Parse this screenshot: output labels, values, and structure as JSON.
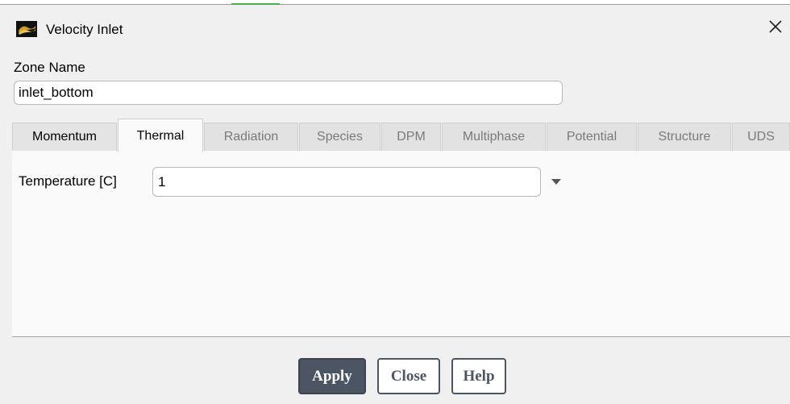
{
  "window": {
    "title": "Velocity Inlet",
    "icon": "ansys-fluent-icon",
    "close_icon": "close-icon"
  },
  "zone": {
    "label": "Zone Name",
    "value": "inlet_bottom"
  },
  "tabs": [
    {
      "label": "Momentum",
      "state": "enabled"
    },
    {
      "label": "Thermal",
      "state": "active"
    },
    {
      "label": "Radiation",
      "state": "disabled"
    },
    {
      "label": "Species",
      "state": "disabled"
    },
    {
      "label": "DPM",
      "state": "disabled"
    },
    {
      "label": "Multiphase",
      "state": "disabled"
    },
    {
      "label": "Potential",
      "state": "disabled"
    },
    {
      "label": "Structure",
      "state": "disabled"
    },
    {
      "label": "UDS",
      "state": "disabled"
    }
  ],
  "thermal": {
    "temperature_label": "Temperature [C]",
    "temperature_value": "1",
    "dropdown_icon": "chevron-down-icon"
  },
  "buttons": {
    "apply": "Apply",
    "close": "Close",
    "help": "Help"
  },
  "colors": {
    "primary_button": "#4b5563",
    "background": "#f0f0f0",
    "panel": "#fafafa"
  }
}
